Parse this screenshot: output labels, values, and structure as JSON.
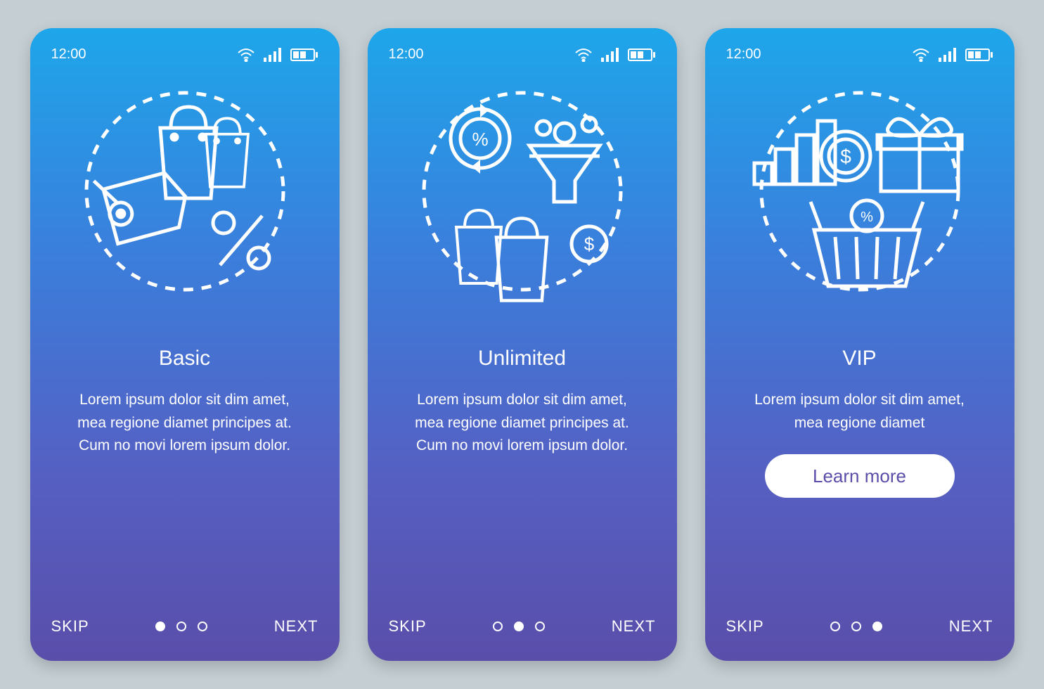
{
  "status": {
    "time": "12:00"
  },
  "nav": {
    "skip": "SKIP",
    "next": "NEXT"
  },
  "screens": [
    {
      "title": "Basic",
      "desc": "Lorem ipsum dolor sit dim amet, mea regione diamet principes at. Cum no movi lorem ipsum dolor.",
      "activeDot": 0,
      "cta": null
    },
    {
      "title": "Unlimited",
      "desc": "Lorem ipsum dolor sit dim amet, mea regione diamet principes at. Cum no movi lorem ipsum dolor.",
      "activeDot": 1,
      "cta": null
    },
    {
      "title": "VIP",
      "desc": "Lorem ipsum dolor sit dim amet, mea regione diamet",
      "activeDot": 2,
      "cta": "Learn more"
    }
  ]
}
